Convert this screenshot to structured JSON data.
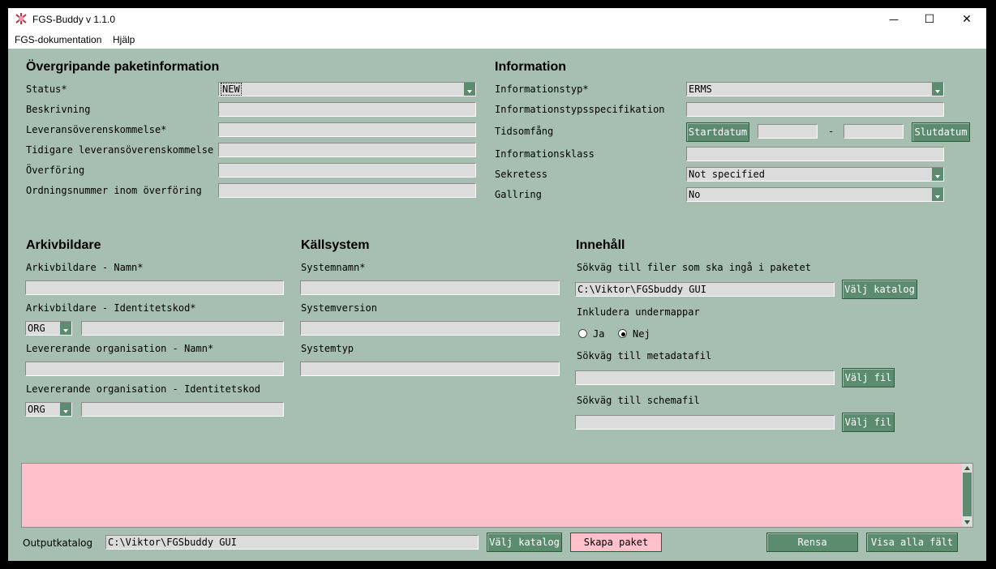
{
  "window": {
    "title": "FGS-Buddy v 1.1.0",
    "minimize_icon": "minimize-icon",
    "maximize_icon": "maximize-icon",
    "close_icon": "close-icon",
    "minimize_glyph": "—",
    "maximize_glyph": "☐",
    "close_glyph": "✕"
  },
  "menu": {
    "items": [
      "FGS-dokumentation",
      "Hjälp"
    ]
  },
  "package_info": {
    "heading": "Övergripande paketinformation",
    "status_label": "Status*",
    "status_value": "NEW",
    "description_label": "Beskrivning",
    "description_value": "",
    "agreement_label": "Leveransöverenskommelse*",
    "agreement_value": "",
    "previous_agreement_label": "Tidigare leveransöverenskommelse",
    "previous_agreement_value": "",
    "transfer_label": "Överföring",
    "transfer_value": "",
    "order_number_label": "Ordningsnummer inom överföring",
    "order_number_value": ""
  },
  "information": {
    "heading": "Information",
    "info_type_label": "Informationstyp*",
    "info_type_value": "ERMS",
    "info_type_spec_label": "Informationstypsspecifikation",
    "info_type_spec_value": "",
    "time_range_label": "Tidsomfång",
    "start_date_button": "Startdatum",
    "start_date_value": "",
    "dash": "-",
    "end_date_value": "",
    "end_date_button": "Slutdatum",
    "info_class_label": "Informationsklass",
    "info_class_value": "",
    "secrecy_label": "Sekretess",
    "secrecy_value": "Not specified",
    "culling_label": "Gallring",
    "culling_value": "No"
  },
  "archive_creator": {
    "heading": "Arkivbildare",
    "name_label": "Arkivbildare - Namn*",
    "name_value": "",
    "id_label": "Arkivbildare - Identitetskod*",
    "id_type": "ORG",
    "id_value": "",
    "delivering_name_label": "Levererande organisation - Namn*",
    "delivering_name_value": "",
    "delivering_id_label": "Levererande organisation - Identitetskod",
    "delivering_id_type": "ORG",
    "delivering_id_value": ""
  },
  "source_system": {
    "heading": "Källsystem",
    "name_label": "Systemnamn*",
    "name_value": "",
    "version_label": "Systemversion",
    "version_value": "",
    "type_label": "Systemtyp",
    "type_value": ""
  },
  "content": {
    "heading": "Innehåll",
    "files_path_label": "Sökväg till filer som ska ingå i paketet",
    "files_path_value": "C:\\Viktor\\FGSbuddy GUI",
    "choose_dir_button": "Välj katalog",
    "include_subdirs_label": "Inkludera undermappar",
    "radio_yes": "Ja",
    "radio_no": "Nej",
    "selected": "Nej",
    "metadata_label": "Sökväg till metadatafil",
    "metadata_value": "",
    "choose_file_button": "Välj fil",
    "schema_label": "Sökväg till schemafil",
    "schema_value": "",
    "choose_schema_button": "Välj fil"
  },
  "log": {
    "text": "",
    "color": "#ffc0cb"
  },
  "footer": {
    "output_label": "Outputkatalog",
    "output_value": "C:\\Viktor\\FGSbuddy GUI",
    "choose_output_button": "Välj katalog",
    "create_button": "Skapa paket",
    "clear_button": "Rensa",
    "show_all_button": "Visa alla fält"
  },
  "colors": {
    "background": "#a6bfb0",
    "button": "#5b8c6f",
    "entry": "#dcdcdc",
    "accent_pink": "#ffc0cb"
  }
}
